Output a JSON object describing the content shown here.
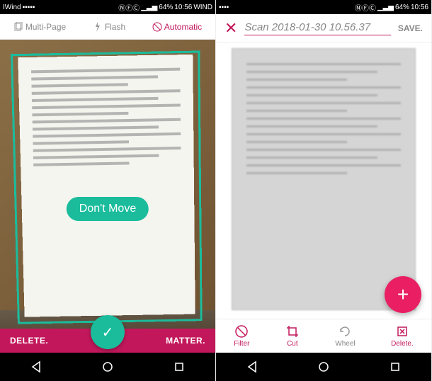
{
  "left": {
    "status": {
      "carrier": "IWind",
      "battery": "64%",
      "time": "10:56",
      "carrier_right": "WIND"
    },
    "toolbar": {
      "multipage_label": "Multi-Page",
      "flash_label": "Flash",
      "automatic_label": "Automatic"
    },
    "capture": {
      "overlay_badge": "Don't Move"
    },
    "bottom": {
      "delete_label": "DELETE.",
      "matter_label": "MATTER."
    }
  },
  "right": {
    "status": {
      "battery": "64%",
      "time": "10:56"
    },
    "header": {
      "title_value": "Scan 2018-01-30 10.56.37",
      "save_label": "SAVE."
    },
    "tabs": {
      "filter_label": "Filter",
      "cut_label": "Cut",
      "wheel_label": "Wheel",
      "delete_label": "Delete."
    }
  },
  "colors": {
    "accent_pink": "#c2185b",
    "accent_teal": "#1abc9c",
    "fab_pink": "#e91e63"
  }
}
